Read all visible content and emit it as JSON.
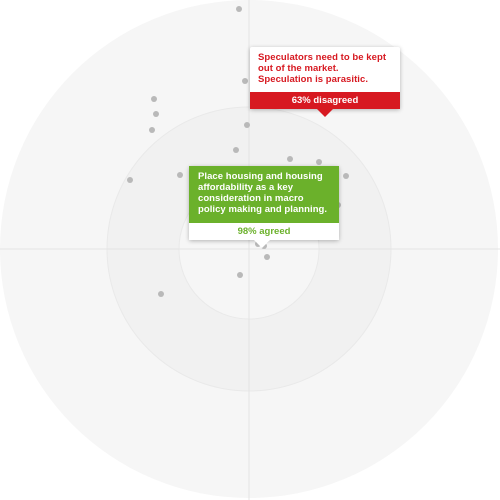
{
  "colors": {
    "agree": "#6bb12b",
    "disagree": "#d71921",
    "dot": "#b9b9b9",
    "ring_outer": "#f6f6f6",
    "ring_middle": "#f1f1f1",
    "ring_inner": "#f6f6f6",
    "axis": "#e6e6e6"
  },
  "tooltips": {
    "disagree": {
      "text": "Speculators need to be kept out of the market. Speculation is parasitic.",
      "result": "63% disagreed"
    },
    "agree": {
      "text": "Place housing and housing affordability as a key consideration in macro policy making and planning.",
      "result": "98% agreed"
    }
  }
}
